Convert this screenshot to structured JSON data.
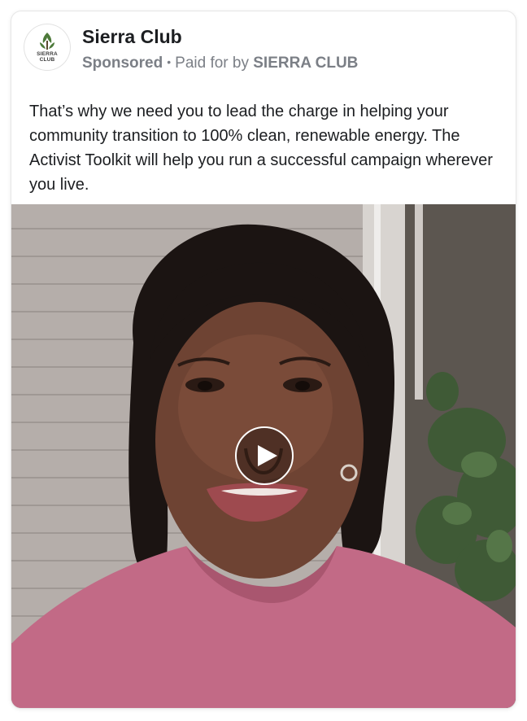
{
  "post": {
    "page_name": "Sierra Club",
    "avatar_logo_text": "SIERRA CLUB",
    "sponsored_label": "Sponsored",
    "separator": "•",
    "paid_for_prefix": "Paid for by",
    "paid_for_name": "SIERRA CLUB",
    "body_text": "That’s why we need you to lead the charge in helping your community transition to 100% clean, renewable energy. The Activist Toolkit will help you run a successful campaign wherever you live."
  },
  "video": {
    "play_icon": "play-icon",
    "colors": {
      "wall": "#b5aeaa",
      "shirt": "#c26a86",
      "skin": "#6e4333",
      "hair": "#1b1412",
      "plant": "#3f5a36"
    }
  }
}
